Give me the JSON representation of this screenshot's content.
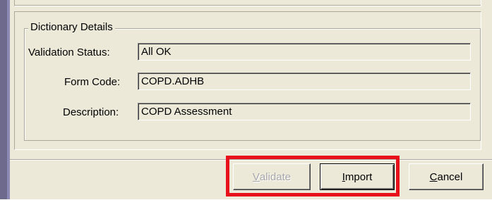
{
  "group": {
    "title": "Dictionary Details"
  },
  "fields": [
    {
      "label": "Validation Status:",
      "value": "All OK"
    },
    {
      "label": "Form Code:",
      "value": "COPD.ADHB"
    },
    {
      "label": "Description:",
      "value": "COPD Assessment"
    }
  ],
  "buttons": {
    "validate": {
      "mnemonic": "V",
      "rest": "alidate",
      "enabled": false
    },
    "import": {
      "mnemonic": "I",
      "rest": "mport"
    },
    "cancel": {
      "mnemonic": "C",
      "rest": "ancel"
    }
  },
  "annotation": {
    "color": "#e8101a"
  }
}
